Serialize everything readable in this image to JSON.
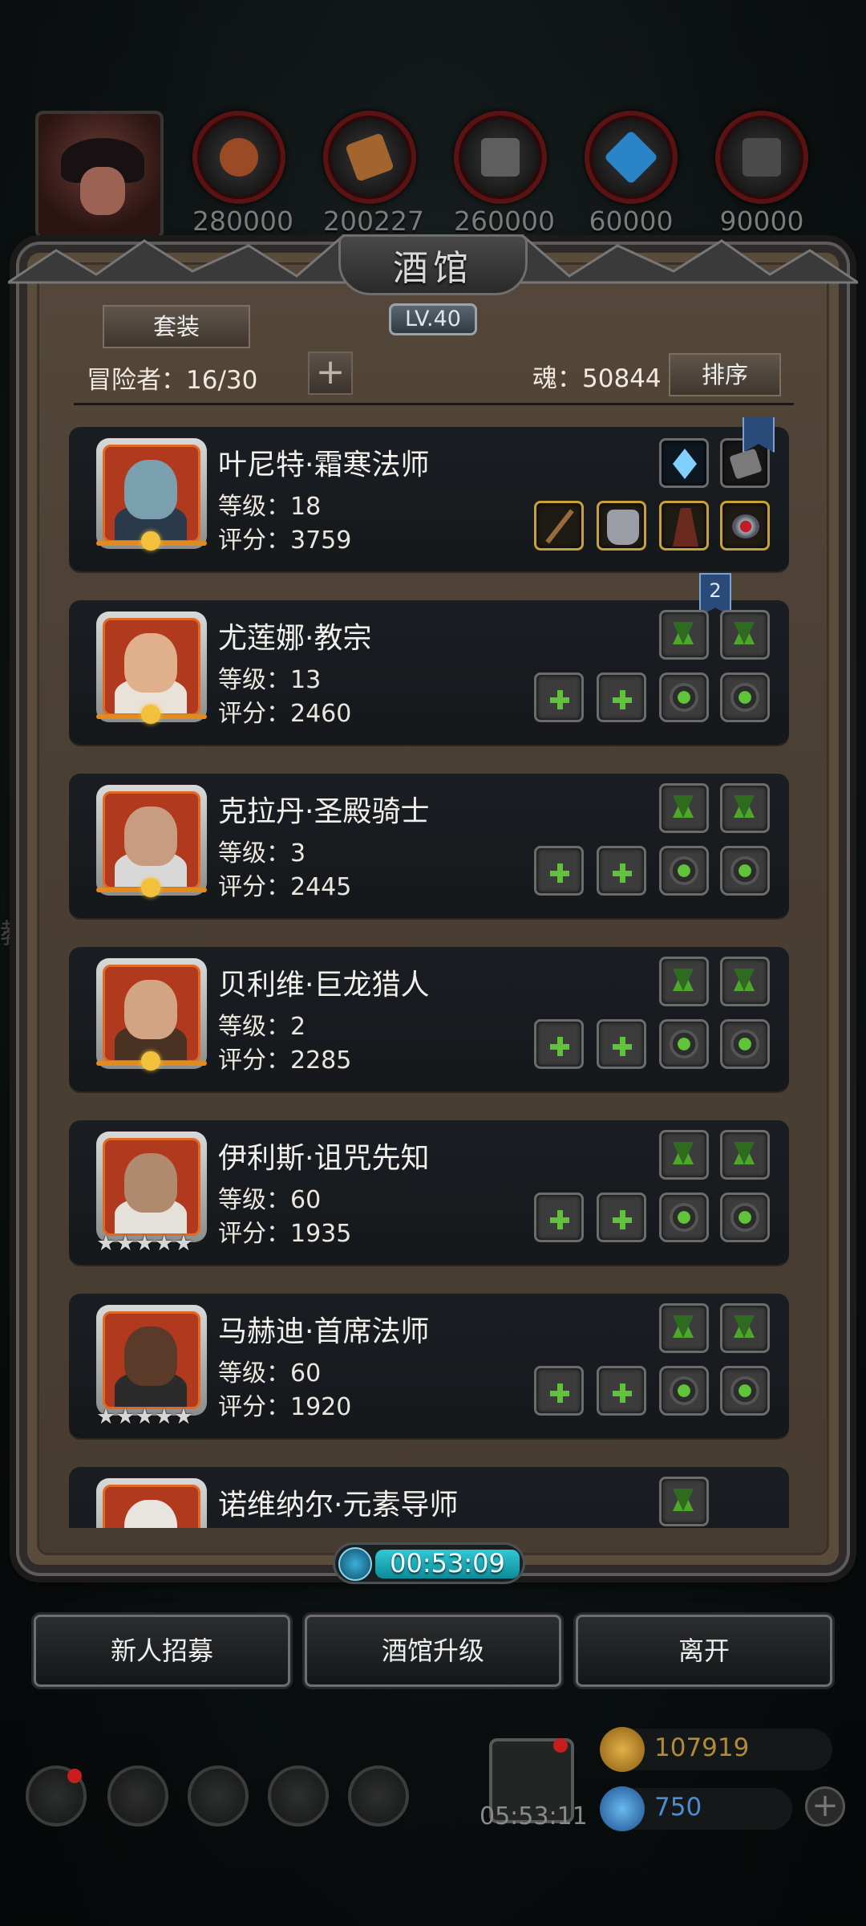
{
  "resources": [
    {
      "name": "leather-icon",
      "value": "280000",
      "color": "#9a4a24"
    },
    {
      "name": "wood-icon",
      "value": "200227",
      "color": "#a3652e"
    },
    {
      "name": "iron-icon",
      "value": "260000",
      "color": "#5e5e5e"
    },
    {
      "name": "crystal-icon",
      "value": "60000",
      "color": "#2a85c8"
    },
    {
      "name": "ore-icon",
      "value": "90000",
      "color": "#4a4a4a"
    }
  ],
  "tavern": {
    "title": "酒馆",
    "level": "LV.40",
    "set_button": "套装",
    "adventurers": "冒险者：16/30",
    "soul": "魂：50844",
    "sort_button": "排序"
  },
  "heroes": [
    {
      "name": "叶尼特·霜寒法师",
      "level": "等级：18",
      "score": "评分：3759",
      "rank": "moon",
      "skin": "#7aa0b0",
      "cloth": "#2a3a4a"
    },
    {
      "name": "尤莲娜·教宗",
      "level": "等级：13",
      "score": "评分：2460",
      "rank": "moon",
      "skin": "#e0b08c",
      "cloth": "#e8e2d8"
    },
    {
      "name": "克拉丹·圣殿骑士",
      "level": "等级：3",
      "score": "评分：2445",
      "rank": "moon",
      "skin": "#c89c80",
      "cloth": "#d8d8d8"
    },
    {
      "name": "贝利维·巨龙猎人",
      "level": "等级：2",
      "score": "评分：2285",
      "rank": "moon",
      "skin": "#d3a483",
      "cloth": "#4a3222"
    },
    {
      "name": "伊利斯·诅咒先知",
      "level": "等级：60",
      "score": "评分：1935",
      "rank": "stars",
      "skin": "#b08a6e",
      "cloth": "#e4e0da"
    },
    {
      "name": "马赫迪·首席法师",
      "level": "等级：60",
      "score": "评分：1920",
      "rank": "stars",
      "skin": "#5a3a28",
      "cloth": "#2b2b2b"
    },
    {
      "name": "诺维纳尔·元素导师",
      "level": "",
      "score": "",
      "rank": "none",
      "skin": "#e8e4e0",
      "cloth": "#cfcfcf"
    }
  ],
  "badge_count": "2",
  "stars": "★★★★★",
  "timer": "00:53:09",
  "buttons": {
    "recruit": "新人招募",
    "upgrade": "酒馆升级",
    "leave": "离开"
  },
  "gift_timer": "05:53:11",
  "gold": "107919",
  "diamonds": "750",
  "side_text": "教"
}
